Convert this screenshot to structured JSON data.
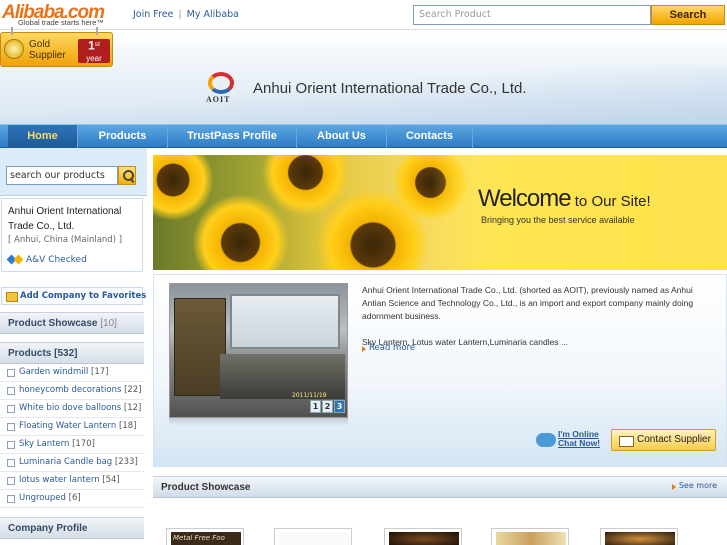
{
  "topbar": {
    "logo_main": "Alibaba.com",
    "logo_tagline": "Global trade starts here™",
    "join_free": "Join Free",
    "my_alibaba": "My Alibaba",
    "separator": "|",
    "search_placeholder": "Search Product",
    "search_button": "Search"
  },
  "badge": {
    "line1": "Gold",
    "line2": "Supplier",
    "years": "1",
    "years_suffix": "st",
    "years_label": "year"
  },
  "header": {
    "logo_text": "AOIT",
    "company_name": "Anhui Orient International Trade Co., Ltd."
  },
  "nav": {
    "items": [
      {
        "label": "Home",
        "active": true
      },
      {
        "label": "Products",
        "active": false
      },
      {
        "label": "TrustPass Profile",
        "active": false
      },
      {
        "label": "About Us",
        "active": false
      },
      {
        "label": "Contacts",
        "active": false
      }
    ]
  },
  "sidebar": {
    "search_value": "search our products",
    "company_name": "Anhui Orient International Trade Co., Ltd.",
    "location": "[ Anhui, China (Mainland) ]",
    "checked": "A&V Checked",
    "add_favorites": "Add Company to Favorites",
    "showcase_label": "Product Showcase",
    "showcase_count": "[10]",
    "products_label": "Products [532]",
    "categories": [
      {
        "name": "Garden windmill",
        "count": "[17]"
      },
      {
        "name": "honeycomb decorations",
        "count": "[22]"
      },
      {
        "name": "White bio dove balloons",
        "count": "[12]"
      },
      {
        "name": "Floating Water Lantern",
        "count": "[18]"
      },
      {
        "name": "Sky Lantern",
        "count": "[170]"
      },
      {
        "name": "Luminaria Candle bag",
        "count": "[233]"
      },
      {
        "name": "lotus water lantern",
        "count": "[54]"
      },
      {
        "name": "Ungrouped",
        "count": "[6]"
      }
    ],
    "company_profile_label": "Company Profile"
  },
  "welcome": {
    "title_big": "Welcome",
    "title_small": " to Our Site!",
    "subtitle": "Bringing you the best service available"
  },
  "about": {
    "paragraph1": "Anhui Orient International Trade Co., Ltd. (shorted as AOIT), previously named as Anhui Antian Science and Technology Co., Ltd., is an import and export company mainly doing adornment business.",
    "paragraph2": "Sky Lantern, Lotus water Lantern,Luminaria candles ...",
    "read_more": "Read more",
    "photo_pages": [
      "1",
      "2",
      "3"
    ],
    "photo_stamp": "2011/11/19"
  },
  "actions": {
    "chat_line1": "I'm Online",
    "chat_line2": "Chat Now!",
    "contact_supplier": "Contact Supplier"
  },
  "showcase": {
    "title": "Product Showcase",
    "see_more": "See more",
    "thumb_text": "Metal Free Foo"
  },
  "colors": {
    "nav_blue": "#2c7cc7",
    "accent_orange": "#e8731a",
    "button_gold": "#f5a300",
    "link_blue": "#2a5a9b"
  }
}
